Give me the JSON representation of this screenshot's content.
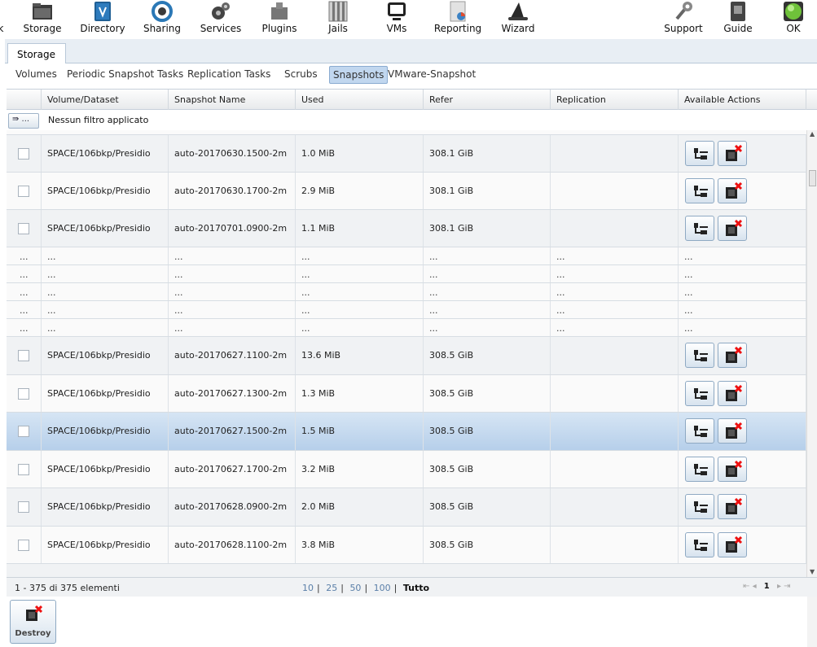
{
  "toolbar": {
    "items": [
      {
        "label": "Storage",
        "icon": "folder-icon"
      },
      {
        "label": "Directory",
        "icon": "directory-icon"
      },
      {
        "label": "Sharing",
        "icon": "sharing-icon"
      },
      {
        "label": "Services",
        "icon": "gears-icon"
      },
      {
        "label": "Plugins",
        "icon": "plugins-icon"
      },
      {
        "label": "Jails",
        "icon": "jails-icon"
      },
      {
        "label": "VMs",
        "icon": "monitor-icon"
      },
      {
        "label": "Reporting",
        "icon": "reporting-icon"
      },
      {
        "label": "Wizard",
        "icon": "wizard-hat-icon"
      }
    ],
    "right": [
      {
        "label": "Support",
        "icon": "support-icon"
      },
      {
        "label": "Guide",
        "icon": "guide-icon"
      },
      {
        "label": "OK",
        "icon": "status-ok-icon"
      }
    ],
    "left_cut": "k"
  },
  "tabs": {
    "main": "Storage"
  },
  "subtabs": [
    "Volumes",
    "Periodic Snapshot Tasks",
    "Replication Tasks",
    "Scrubs",
    "Snapshots",
    "VMware-Snapshot"
  ],
  "subtab_active": "Snapshots",
  "grid": {
    "columns": [
      "Volume/Dataset",
      "Snapshot Name",
      "Used",
      "Refer",
      "Replication",
      "Available Actions"
    ],
    "filter_button": "⇛ ...",
    "filter_text": "Nessun filtro applicato",
    "rows_top": [
      {
        "dataset": "SPACE/106bkp/Presidio",
        "name": "auto-20170630.1500-2m",
        "used": "1.0 MiB",
        "refer": "308.1 GiB"
      },
      {
        "dataset": "SPACE/106bkp/Presidio",
        "name": "auto-20170630.1700-2m",
        "used": "2.9 MiB",
        "refer": "308.1 GiB"
      },
      {
        "dataset": "SPACE/106bkp/Presidio",
        "name": "auto-20170701.0900-2m",
        "used": "1.1 MiB",
        "refer": "308.1 GiB"
      }
    ],
    "ellipsis": "...",
    "rows_bottom": [
      {
        "dataset": "SPACE/106bkp/Presidio",
        "name": "auto-20170627.1100-2m",
        "used": "13.6 MiB",
        "refer": "308.5 GiB"
      },
      {
        "dataset": "SPACE/106bkp/Presidio",
        "name": "auto-20170627.1300-2m",
        "used": "1.3 MiB",
        "refer": "308.5 GiB"
      },
      {
        "dataset": "SPACE/106bkp/Presidio",
        "name": "auto-20170627.1500-2m",
        "used": "1.5 MiB",
        "refer": "308.5 GiB"
      },
      {
        "dataset": "SPACE/106bkp/Presidio",
        "name": "auto-20170627.1700-2m",
        "used": "3.2 MiB",
        "refer": "308.5 GiB"
      },
      {
        "dataset": "SPACE/106bkp/Presidio",
        "name": "auto-20170628.0900-2m",
        "used": "2.0 MiB",
        "refer": "308.5 GiB"
      },
      {
        "dataset": "SPACE/106bkp/Presidio",
        "name": "auto-20170628.1100-2m",
        "used": "3.8 MiB",
        "refer": "308.5 GiB"
      }
    ]
  },
  "pager": {
    "info": "1 - 375 di 375 elementi",
    "sizes": [
      "10",
      "25",
      "50",
      "100",
      "Tutto"
    ],
    "page": "1"
  },
  "bottom": {
    "destroy_label": "Destroy"
  }
}
